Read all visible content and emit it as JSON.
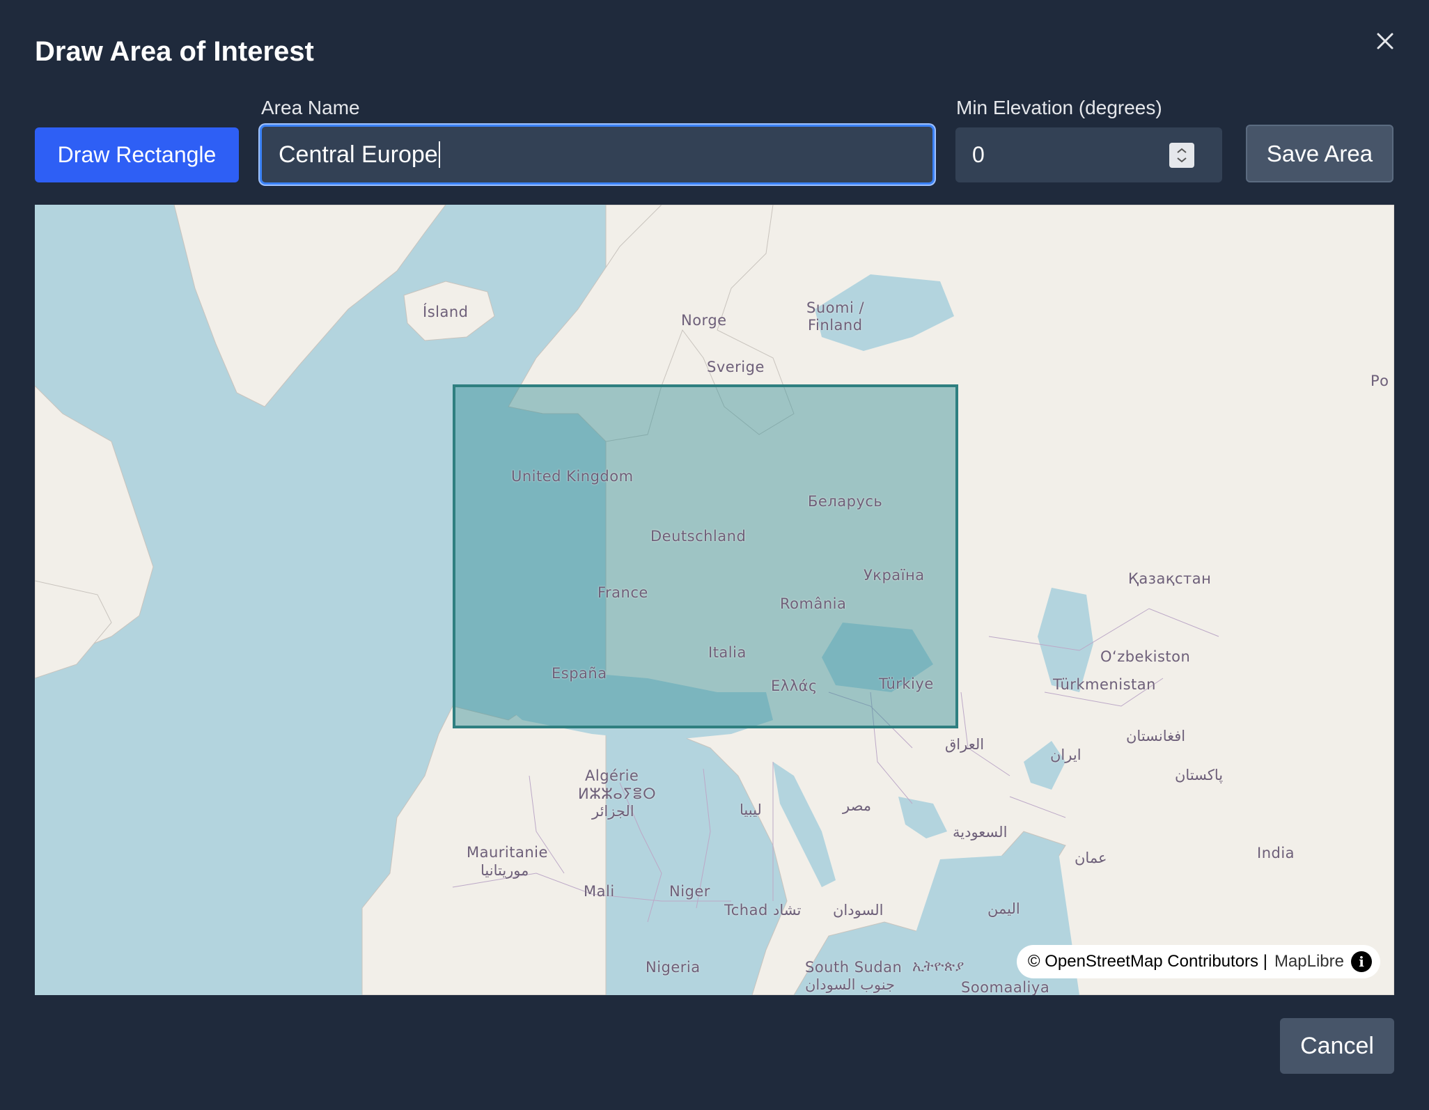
{
  "dialog": {
    "title": "Draw Area of Interest",
    "close_icon": "close-icon"
  },
  "toolbar": {
    "draw_label": "Draw Rectangle",
    "area_name_label": "Area Name",
    "area_name_value": "Central Europe",
    "min_elev_label": "Min Elevation (degrees)",
    "min_elev_value": "0",
    "save_label": "Save Area"
  },
  "map": {
    "places": [
      "Ísland",
      "Norge",
      "Suomi /",
      "Finland",
      "Sverige",
      "Ро",
      "United Kingdom",
      "Беларусь",
      "Deutschland",
      "Україна",
      "France",
      "România",
      "Қазақстан",
      "Italia",
      "Oʻzbekiston",
      "España",
      "Ελλάς",
      "Türkiye",
      "Türkmenistan",
      "العراق",
      "افغانستان",
      "ایران",
      "پاکستان",
      "Algérie",
      "ⵍⵣⵣⴰⵢⴻⵔ",
      "الجزائر",
      "ليبيا",
      "مصر",
      "السعودية",
      "عمان",
      "India",
      "Mauritanie",
      "موريتانيا",
      "Mali",
      "Niger",
      "Tchad تشاد",
      "السودان",
      "اليمن",
      "Nigeria",
      "South Sudan",
      "جنوب السودان",
      "ኢትዮጵያ",
      "Soomaaliya"
    ],
    "attribution": "© OpenStreetMap Contributors |",
    "attribution_link": "MapLibre",
    "info_glyph": "i",
    "selection_color": "#389196",
    "water_color": "#b3d4de",
    "land_color": "#f2efe9"
  },
  "footer": {
    "cancel_label": "Cancel"
  }
}
